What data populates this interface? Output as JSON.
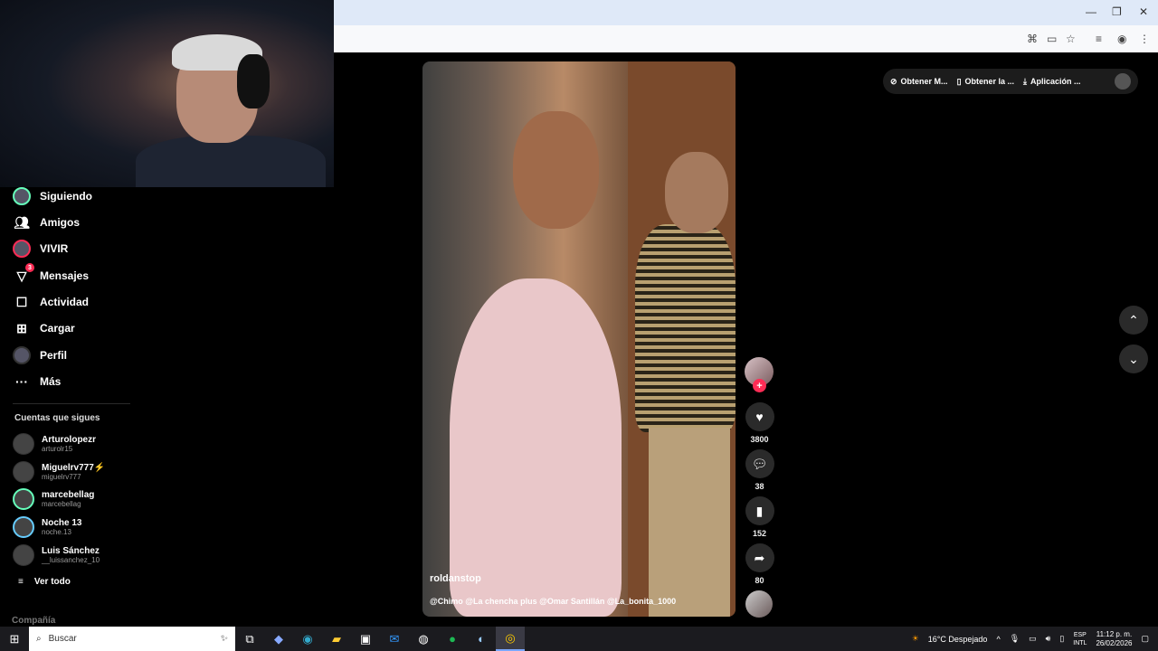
{
  "browser": {
    "window_controls": {
      "minimize": "—",
      "restore": "❐",
      "close": "✕"
    },
    "toolbar_icons": [
      "translate-icon",
      "cast-icon",
      "star-icon",
      "reading-list-icon",
      "profile-icon",
      "menu-icon"
    ]
  },
  "sidebar": {
    "nav": [
      {
        "label": "Siguiendo",
        "icon": "following-avatar-icon"
      },
      {
        "label": "Amigos",
        "icon": "friends-icon"
      },
      {
        "label": "VIVIR",
        "icon": "live-icon"
      },
      {
        "label": "Mensajes",
        "icon": "messages-icon",
        "badge": "3"
      },
      {
        "label": "Actividad",
        "icon": "activity-icon"
      },
      {
        "label": "Cargar",
        "icon": "upload-icon"
      },
      {
        "label": "Perfil",
        "icon": "profile-avatar-icon"
      },
      {
        "label": "Más",
        "icon": "more-icon"
      }
    ],
    "following_title": "Cuentas que sigues",
    "accounts": [
      {
        "name": "Arturolopezr",
        "handle": "arturolr15"
      },
      {
        "name": "Miguelrv777⚡",
        "handle": "miguelrv777"
      },
      {
        "name": "marcebellag",
        "handle": "marcebellag"
      },
      {
        "name": "Noche 13",
        "handle": "noche.13"
      },
      {
        "name": "Luis Sánchez",
        "handle": "__luissanchez_10"
      }
    ],
    "see_all": "Ver todo",
    "company": "Compañía"
  },
  "video": {
    "author": "roldanstop",
    "caption": "@Chimo  @La chencha plus @Omar Santillán @La_bonita_1000"
  },
  "actions": {
    "likes": "3800",
    "comments": "38",
    "saves": "152",
    "shares": "80",
    "follow_plus": "+"
  },
  "topbar": {
    "coins": "Obtener M...",
    "app_get": "Obtener la ...",
    "app": "Aplicación ..."
  },
  "nav_buttons": {
    "up": "⌃",
    "down": "⌄"
  },
  "taskbar": {
    "search_placeholder": "Buscar",
    "weather": "16°C  Despejado",
    "lang_top": "ESP",
    "lang_bottom": "INTL",
    "time": "11:12 p. m.",
    "date": "26/02/2026"
  }
}
